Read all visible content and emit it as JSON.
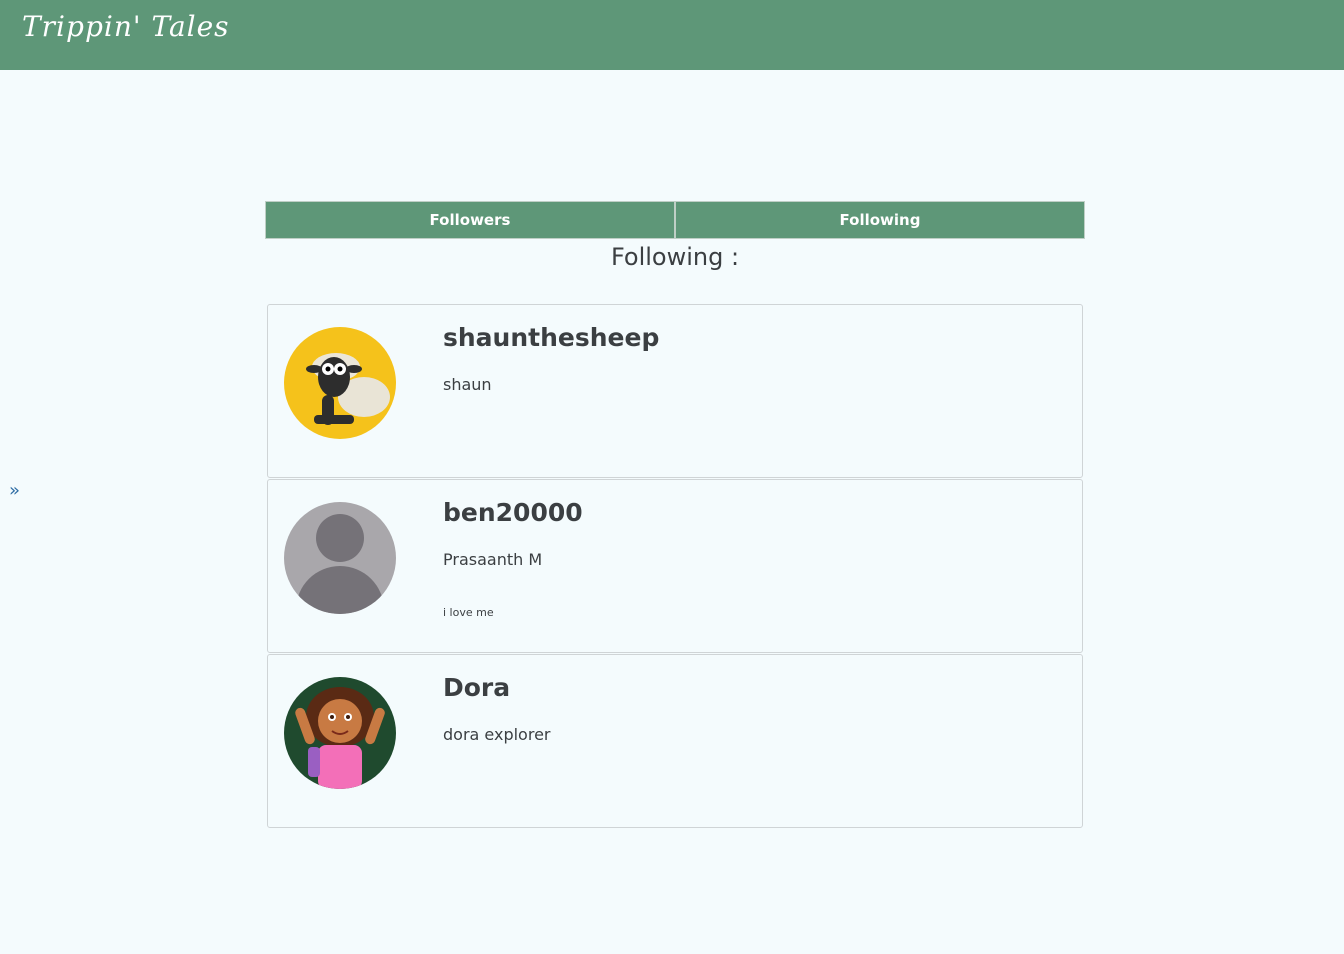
{
  "navbar": {
    "brand": "Trippin' Tales"
  },
  "sidebar": {
    "toggle_glyph": "»"
  },
  "tabs": [
    {
      "label": "Followers"
    },
    {
      "label": "Following"
    }
  ],
  "section": {
    "title": "Following :"
  },
  "users": [
    {
      "username": "shaunthesheep",
      "fullname": "shaun",
      "bio": "",
      "avatar": "sheep-avatar"
    },
    {
      "username": "ben20000",
      "fullname": "Prasaanth M",
      "bio": "i love me",
      "avatar": "default-user-avatar"
    },
    {
      "username": "Dora",
      "fullname": "dora explorer",
      "bio": "",
      "avatar": "dora-avatar"
    }
  ],
  "colors": {
    "accent": "#5e9778",
    "background": "#f4fbfd",
    "text": "#3b3f42",
    "link": "#2e6da4"
  }
}
